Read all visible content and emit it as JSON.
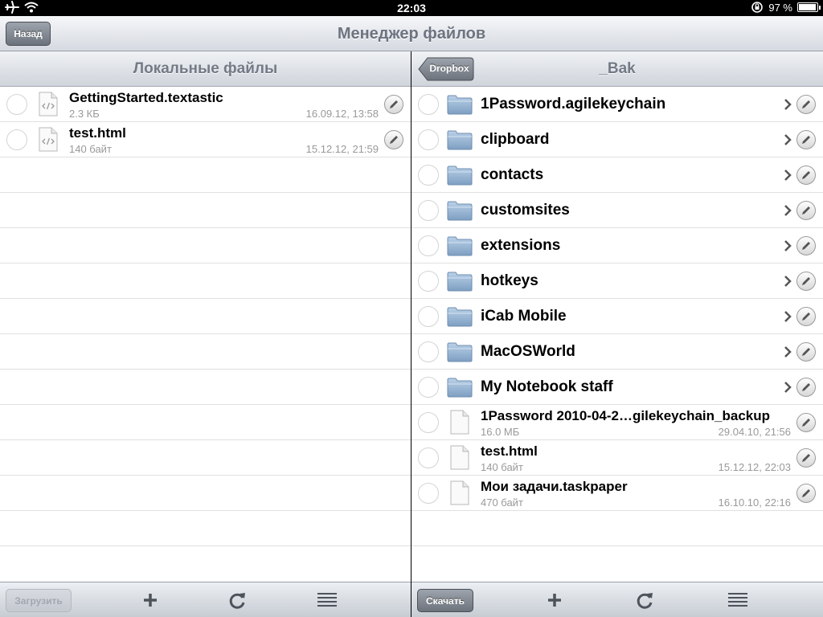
{
  "status": {
    "time": "22:03",
    "battery": "97 %",
    "battery_level": 0.97
  },
  "nav": {
    "title": "Менеджер файлов",
    "back_label": "Назад"
  },
  "local": {
    "title": "Локальные файлы",
    "files": [
      {
        "name": "GettingStarted.textastic",
        "size": "2.3 КБ",
        "date": "16.09.12, 13:58"
      },
      {
        "name": "test.html",
        "size": "140 байт",
        "date": "15.12.12, 21:59"
      }
    ],
    "toolbar": {
      "upload_label": "Загрузить"
    }
  },
  "remote": {
    "title": "_Bak",
    "back_label": "Dropbox",
    "folders": [
      "1Password.agilekeychain",
      "clipboard",
      "contacts",
      "customsites",
      "extensions",
      "hotkeys",
      "iCab Mobile",
      "MacOSWorld",
      "My Notebook staff"
    ],
    "files": [
      {
        "name": "1Password 2010-04-2…gilekeychain_backup",
        "size": "16.0 МБ",
        "date": "29.04.10, 21:56"
      },
      {
        "name": "test.html",
        "size": "140 байт",
        "date": "15.12.12, 22:03"
      },
      {
        "name": "Мои задачи.taskpaper",
        "size": "470 байт",
        "date": "16.10.10, 22:16"
      }
    ],
    "toolbar": {
      "download_label": "Скачать"
    }
  },
  "icons": {
    "airplane": "airplane-icon",
    "wifi": "wifi-icon",
    "lock": "rotation-lock-icon",
    "battery": "battery-icon",
    "add": "plus-icon",
    "refresh": "refresh-icon",
    "list": "list-icon",
    "edit": "pencil-icon",
    "chevron": "chevron-right-icon",
    "folder": "folder-icon",
    "doc": "document-icon",
    "code_doc": "code-document-icon"
  }
}
